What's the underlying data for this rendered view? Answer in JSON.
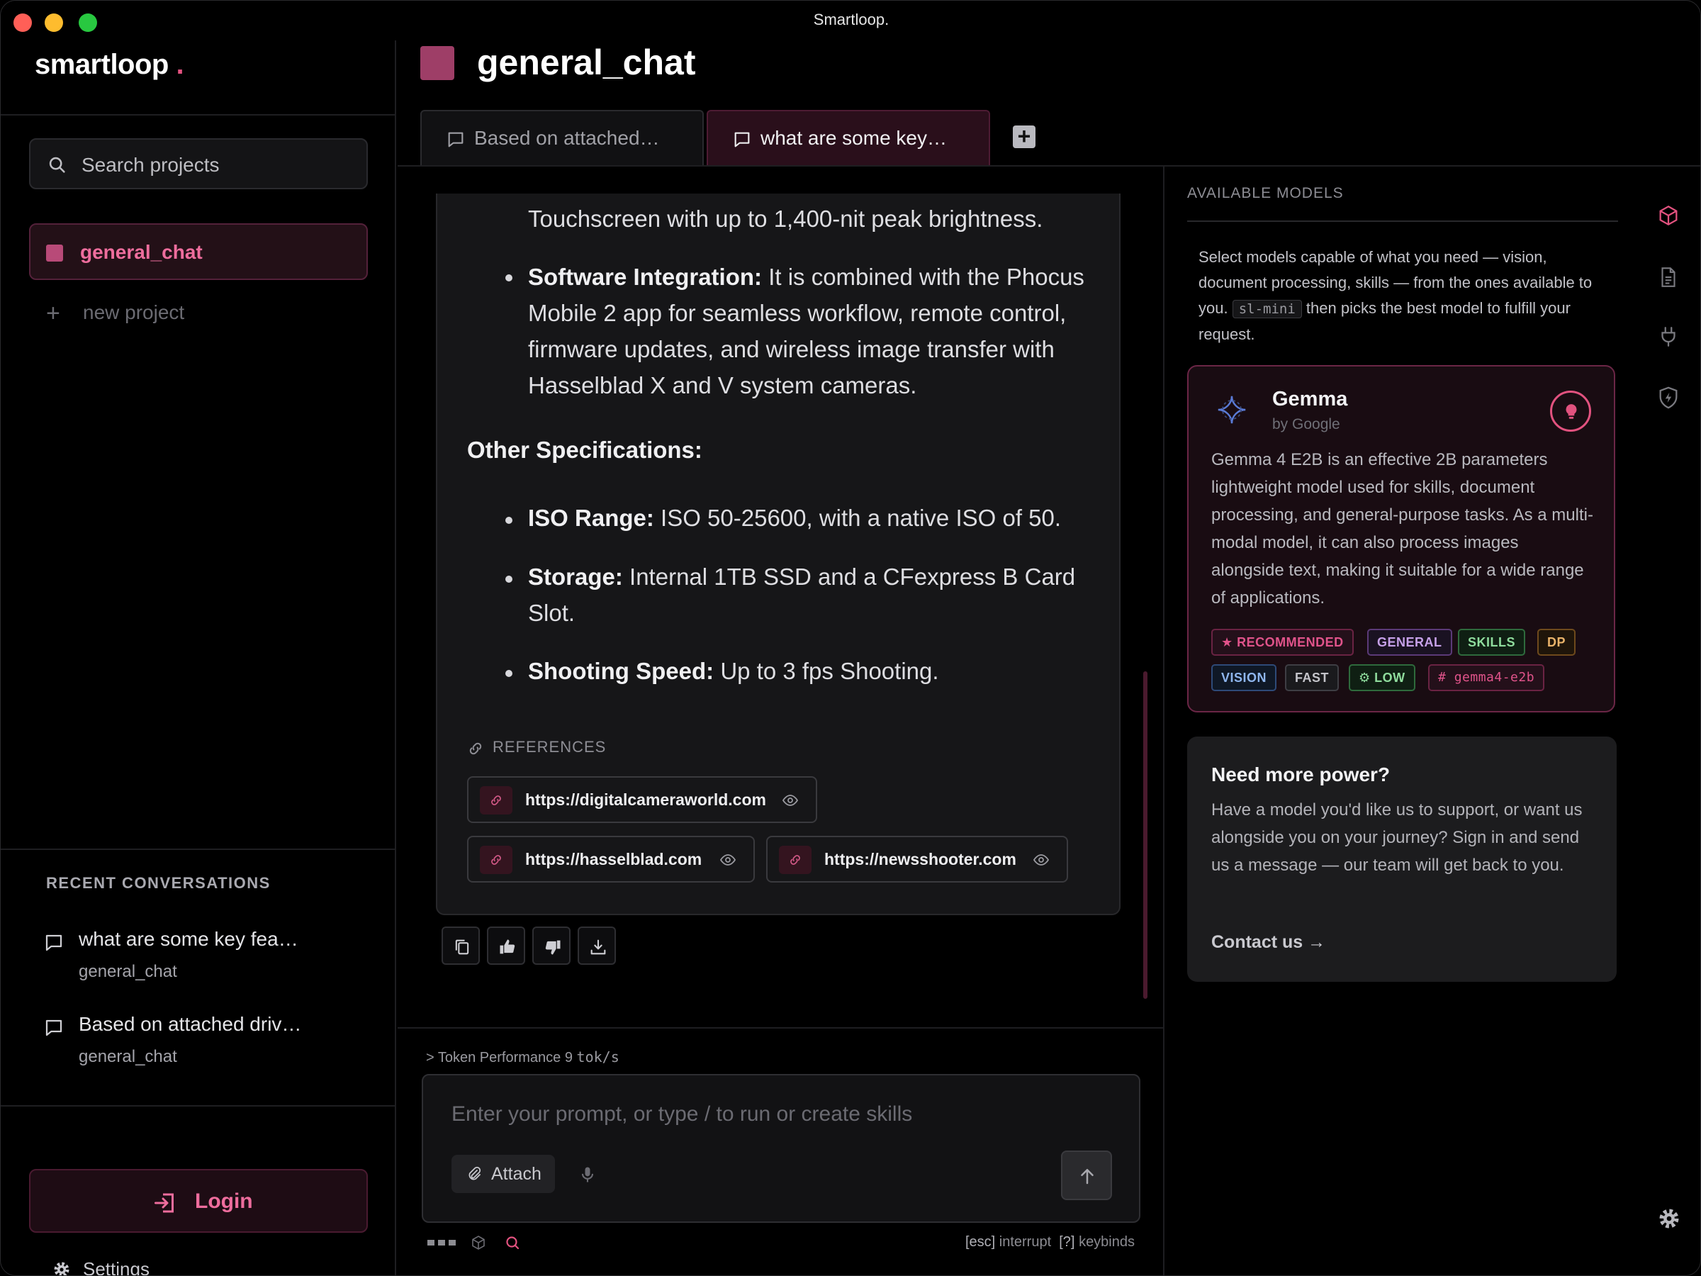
{
  "window": {
    "title": "Smartloop."
  },
  "sidebar": {
    "logo": "smartloop",
    "logo_dot": ".",
    "search_placeholder": "Search projects",
    "active_project": "general_chat",
    "new_project": "new project",
    "recent_heading": "RECENT CONVERSATIONS",
    "recent": [
      {
        "title": "what are some key fea…",
        "project": "general_chat"
      },
      {
        "title": "Based on attached driv…",
        "project": "general_chat"
      }
    ],
    "login": "Login",
    "settings": "Settings"
  },
  "header": {
    "title": "general_chat",
    "tabs": [
      {
        "label": "Based on attached…"
      },
      {
        "label": "what are some key…"
      }
    ],
    "add_tab": "+"
  },
  "message": {
    "line0": "Touchscreen with up to 1,400-nit peak brightness.",
    "bullets_a": [
      {
        "label": "Software Integration:",
        "l1": "It is combined with the Phocus",
        "l2": "Mobile 2 app for seamless workflow, remote control,",
        "l3": "firmware updates, and wireless image transfer with",
        "l4": "Hasselblad X and V system cameras."
      }
    ],
    "section": "Other Specifications:",
    "bullets_b": [
      {
        "label": "ISO Range:",
        "text": "ISO 50-25600, with a native ISO of 50."
      },
      {
        "label": "Storage:",
        "text": "Internal 1TB SSD and a CFexpress B Card",
        "text2": "Slot."
      },
      {
        "label": "Shooting Speed:",
        "text": "Up to 3 fps Shooting."
      }
    ],
    "references_heading": "REFERENCES",
    "references": [
      "https://digitalcameraworld.com",
      "https://hasselblad.com",
      "https://newsshooter.com"
    ]
  },
  "composer": {
    "token_prefix": "> Token Performance",
    "token_value": "9",
    "token_unit": "tok/s",
    "placeholder": "Enter your prompt, or type / to run or create skills",
    "attach": "Attach",
    "hint_esc_key": "[esc]",
    "hint_esc": "interrupt",
    "hint_help_key": "[?]",
    "hint_help": "keybinds"
  },
  "models": {
    "heading": "AVAILABLE MODELS",
    "desc_a": "Select models capable of what you need — vision, document processing, skills — from the ones available to you.",
    "desc_code": "sl-mini",
    "desc_b": "then picks the best model to fulfill your request.",
    "card": {
      "name": "Gemma",
      "by": "by Google",
      "description": "Gemma 4 E2B is an effective 2B parameters lightweight model used for skills, document processing, and general-purpose tasks. As a multi-modal model, it can also process images alongside text, making it suitable for a wide range of applications.",
      "tags": [
        "RECOMMENDED",
        "GENERAL",
        "SKILLS",
        "DP",
        "VISION",
        "FAST",
        "LOW",
        "gemma4-e2b"
      ]
    },
    "power": {
      "title": "Need more power?",
      "text": "Have a model you'd like us to support, or want us alongside you on your journey? Sign in and send us a message — our team will get back to you.",
      "contact": "Contact us →"
    }
  },
  "colors": {
    "accent": "#e2527f",
    "bg": "#000000",
    "panel": "#161618"
  }
}
